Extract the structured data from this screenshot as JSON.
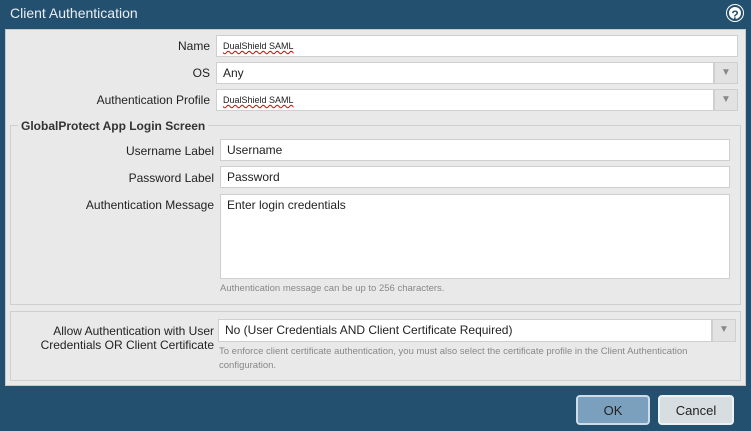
{
  "dialog": {
    "title": "Client Authentication",
    "help_icon": "help-circle-icon"
  },
  "fields": {
    "name": {
      "label": "Name",
      "value": "DualShield SAML"
    },
    "os": {
      "label": "OS",
      "value": "Any"
    },
    "auth_profile": {
      "label": "Authentication Profile",
      "value": "DualShield SAML"
    }
  },
  "login_screen": {
    "title": "GlobalProtect App Login Screen",
    "username": {
      "label": "Username Label",
      "value": "Username"
    },
    "password": {
      "label": "Password Label",
      "value": "Password"
    },
    "message": {
      "label": "Authentication Message",
      "value": "Enter login credentials",
      "hint": "Authentication message can be up to 256 characters."
    }
  },
  "allow_auth": {
    "label_line1": "Allow Authentication with User",
    "label_line2": "Credentials OR Client Certificate",
    "value": "No (User Credentials AND Client Certificate Required)",
    "hint": "To enforce client certificate authentication, you must also select the certificate profile in the Client Authentication configuration."
  },
  "buttons": {
    "ok": "OK",
    "cancel": "Cancel"
  }
}
